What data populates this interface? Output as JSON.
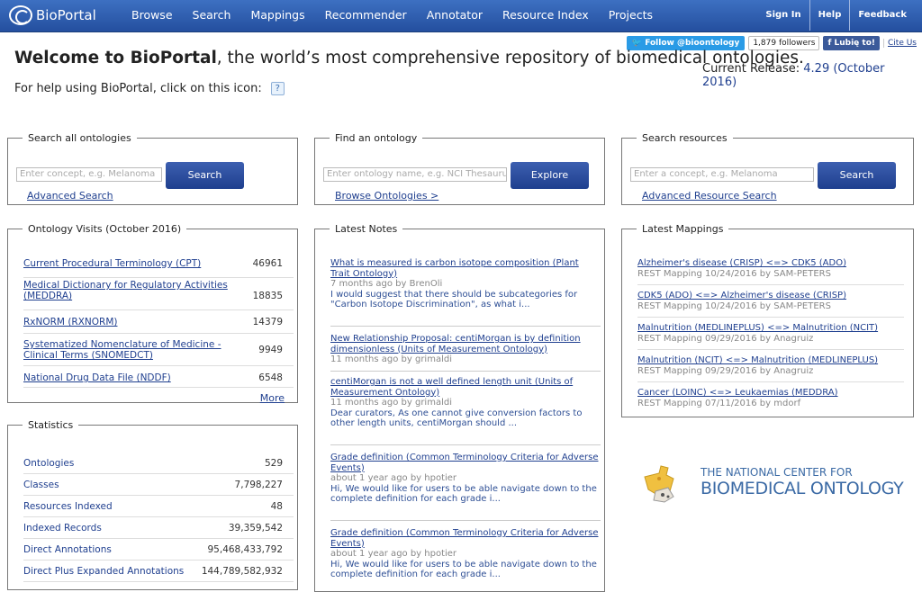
{
  "brand": "BioPortal",
  "nav": [
    "Browse",
    "Search",
    "Mappings",
    "Recommender",
    "Annotator",
    "Resource Index",
    "Projects"
  ],
  "right_nav": [
    "Sign In",
    "Help",
    "Feedback"
  ],
  "social": {
    "twitter": "Follow @bioontology",
    "followers": "1,879 followers",
    "facebook": "Lubię to!",
    "cite": "Cite Us"
  },
  "welcome": {
    "bold": "Welcome to BioPortal",
    "rest": ", the world’s most comprehensive repository of biomedical ontologies."
  },
  "release": {
    "label": "Current Release:",
    "value": "4.29 (October 2016)"
  },
  "help_text": "For help using BioPortal, click on this icon:",
  "search_all": {
    "legend": "Search all ontologies",
    "placeholder": "Enter concept, e.g. Melanoma",
    "button": "Search",
    "link": "Advanced Search"
  },
  "find_ontology": {
    "legend": "Find an ontology",
    "placeholder": "Enter ontology name, e.g. NCI Thesaurus",
    "button": "Explore",
    "link": "Browse Ontologies >"
  },
  "search_resources": {
    "legend": "Search resources",
    "placeholder": "Enter a concept, e.g. Melanoma",
    "button": "Search",
    "link": "Advanced Resource Search"
  },
  "visits": {
    "legend": "Ontology Visits (October 2016)",
    "rows": [
      {
        "name": "Current Procedural Terminology (CPT)",
        "count": "46961"
      },
      {
        "name": "Medical Dictionary for Regulatory Activities (MEDDRA)",
        "count": "18835"
      },
      {
        "name": "RxNORM (RXNORM)",
        "count": "14379"
      },
      {
        "name": "Systematized Nomenclature of Medicine - Clinical Terms (SNOMEDCT)",
        "count": "9949"
      },
      {
        "name": "National Drug Data File (NDDF)",
        "count": "6548"
      }
    ],
    "more": "More"
  },
  "stats": {
    "legend": "Statistics",
    "rows": [
      {
        "name": "Ontologies",
        "value": "529"
      },
      {
        "name": "Classes",
        "value": "7,798,227"
      },
      {
        "name": "Resources Indexed",
        "value": "48"
      },
      {
        "name": "Indexed Records",
        "value": "39,359,542"
      },
      {
        "name": "Direct Annotations",
        "value": "95,468,433,792"
      },
      {
        "name": "Direct Plus Expanded Annotations",
        "value": "144,789,582,932"
      }
    ]
  },
  "notes": {
    "legend": "Latest Notes",
    "items": [
      {
        "title": "What is measured is carbon isotope composition (Plant Trait Ontology)",
        "meta": "7 months ago by BrenOli",
        "body": "I would suggest that there should be subcategories for \"Carbon Isotope Discrimination\", as what i..."
      },
      {
        "title": "New Relationship Proposal: centiMorgan is by definition dimensionless (Units of Measurement Ontology)",
        "meta": "11 months ago by grimaldi",
        "body": ""
      },
      {
        "title": "centiMorgan is not a well defined length unit (Units of Measurement Ontology)",
        "meta": "11 months ago by grimaldi",
        "body": "Dear curators, As one cannot give conversion factors to other length units, centiMorgan should ..."
      },
      {
        "title": "Grade definition (Common Terminology Criteria for Adverse Events)",
        "meta": "about 1 year ago by hpotier",
        "body": "Hi, We would like for users to be able navigate down to the complete definition for each grade i..."
      },
      {
        "title": "Grade definition (Common Terminology Criteria for Adverse Events)",
        "meta": "about 1 year ago by hpotier",
        "body": "Hi, We would like for users to be able navigate down to the complete definition for each grade i..."
      }
    ]
  },
  "mappings": {
    "legend": "Latest Mappings",
    "items": [
      {
        "title": "Alzheimer's disease (CRISP) <=> CDK5 (ADO)",
        "meta": "REST Mapping 10/24/2016 by SAM-PETERS"
      },
      {
        "title": "CDK5 (ADO) <=> Alzheimer's disease (CRISP)",
        "meta": "REST Mapping 10/24/2016 by SAM-PETERS"
      },
      {
        "title": "Malnutrition (MEDLINEPLUS) <=> Malnutrition (NCIT)",
        "meta": "REST Mapping 09/29/2016 by Anagruiz"
      },
      {
        "title": "Malnutrition (NCIT) <=> Malnutrition (MEDLINEPLUS)",
        "meta": "REST Mapping 09/29/2016 by Anagruiz"
      },
      {
        "title": "Cancer (LOINC) <=> Leukaemias (MEDDRA)",
        "meta": "REST Mapping 07/11/2016 by mdorf"
      }
    ]
  },
  "ncbo": {
    "line1": "THE NATIONAL CENTER FOR",
    "line2": "BIOMEDICAL ONTOLOGY"
  }
}
